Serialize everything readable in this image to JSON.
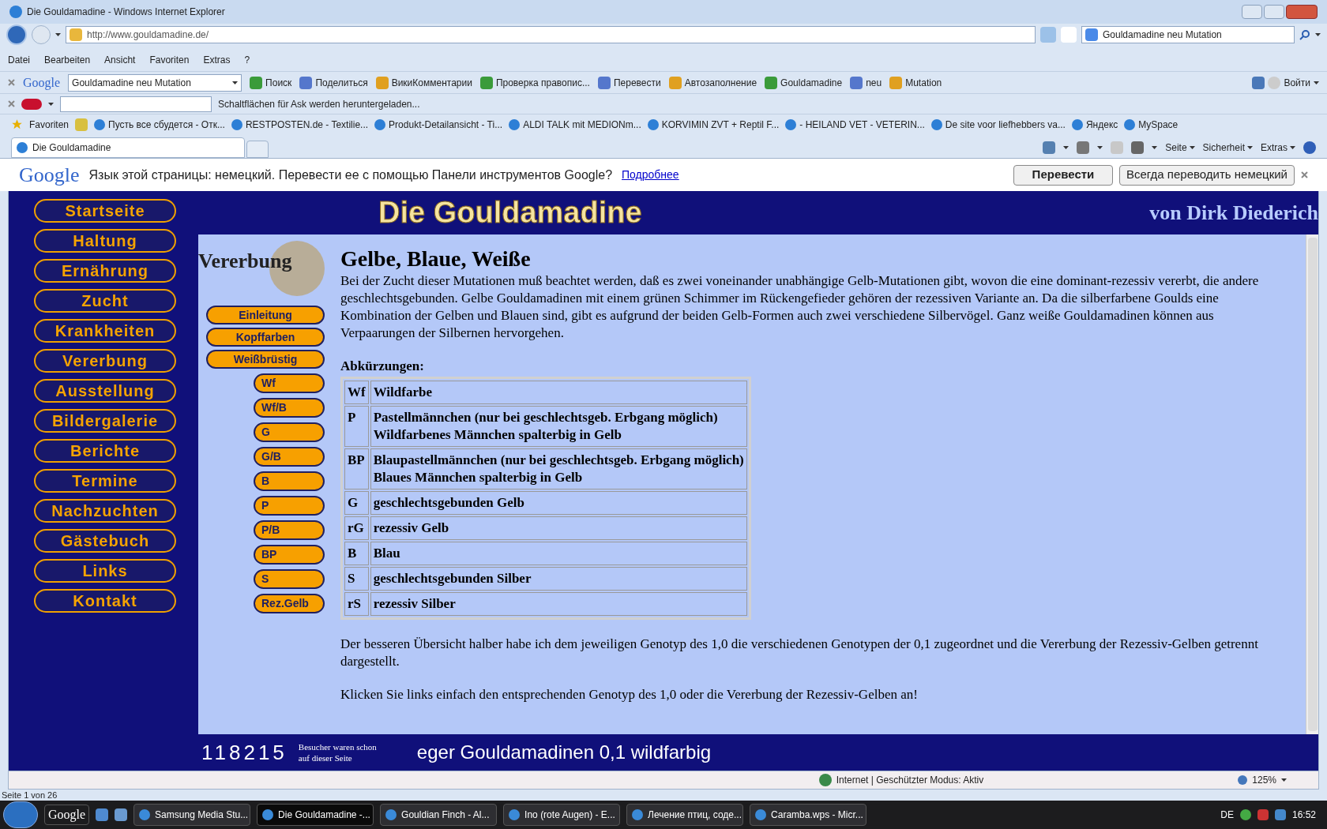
{
  "window": {
    "title": "Die Gouldamadine - Windows Internet Explorer"
  },
  "address": {
    "url": "http://www.gouldamadine.de/"
  },
  "search": {
    "value": "Gouldamadine neu Mutation"
  },
  "menu": [
    "Datei",
    "Bearbeiten",
    "Ansicht",
    "Favoriten",
    "Extras",
    "?"
  ],
  "google_toolbar": {
    "logo": "Google",
    "query": "Gouldamadine neu Mutation",
    "items": [
      "Поиск",
      "Поделиться",
      "ВикиКомментарии",
      "Проверка правопис...",
      "Перевести",
      "Автозаполнение",
      "Gouldamadine",
      "neu",
      "Mutation"
    ],
    "sign_in": "Войти"
  },
  "ask_toolbar": {
    "status": "Schaltflächen für Ask werden heruntergeladen..."
  },
  "favorites_bar": {
    "label": "Favoriten",
    "links": [
      "Пусть все сбудется - Отк...",
      "RESTPOSTEN.de - Textilie...",
      "Produkt-Detailansicht - Ti...",
      "ALDI TALK mit MEDIONm...",
      "KORVIMIN ZVT + Reptil F...",
      "- HEILAND VET - VETERIN...",
      "De site voor liefhebbers va...",
      "Яндекс",
      "MySpace"
    ]
  },
  "tabs": [
    {
      "label": "Die Gouldamadine",
      "selected": true
    }
  ],
  "command_bar": [
    "Seite",
    "Sicherheit",
    "Extras"
  ],
  "translate_bar": {
    "logo": "Google",
    "message": "Язык этой страницы: немецкий. Перевести ее с помощью Панели инструментов Google?",
    "link": "Подробнее",
    "buttons": [
      "Перевести",
      "Всегда переводить немецкий"
    ]
  },
  "page": {
    "title": "Die Gouldamadine",
    "author": "von Dirk Diederich",
    "nav": [
      "Startseite",
      "Haltung",
      "Ernährung",
      "Zucht",
      "Krankheiten",
      "Vererbung",
      "Ausstellung",
      "Bildergalerie",
      "Berichte",
      "Termine",
      "Nachzuchten",
      "Gästebuch",
      "Links",
      "Kontakt"
    ],
    "section_logo": "Vererbung",
    "subnav": [
      "Einleitung",
      "Kopffarben",
      "Weißbrüstig"
    ],
    "genotypes": [
      "Wf",
      "Wf/B",
      "G",
      "G/B",
      "B",
      "P",
      "P/B",
      "BP",
      "S",
      "Rez.Gelb"
    ],
    "heading": "Gelbe, Blaue, Weiße",
    "intro": "Bei der Zucht dieser Mutationen muß beachtet werden, daß es zwei voneinander unabhängige Gelb-Mutationen gibt, wovon die eine dominant-rezessiv vererbt, die andere geschlechtsgebunden. Gelbe Gouldamadinen mit einem grünen Schimmer im Rückengefieder gehören der rezessiven Variante an. Da die silberfarbene Goulds eine Kombination der Gelben und Blauen sind, gibt es aufgrund der beiden Gelb-Formen auch zwei verschiedene Silbervögel. Ganz weiße Gouldamadinen können aus Verpaarungen der Silbernen hervorgehen.",
    "abbrev_title": "Abkürzungen:",
    "abbreviations": [
      {
        "code": "Wf",
        "lines": [
          "Wildfarbe"
        ]
      },
      {
        "code": "P",
        "lines": [
          "Pastellmännchen (nur bei geschlechtsgeb. Erbgang möglich)",
          "Wildfarbenes Männchen spalterbig in Gelb"
        ]
      },
      {
        "code": "BP",
        "lines": [
          "Blaupastellmännchen (nur bei geschlechtsgeb. Erbgang möglich)",
          "Blaues Männchen spalterbig in Gelb"
        ]
      },
      {
        "code": "G",
        "lines": [
          "geschlechtsgebunden Gelb"
        ]
      },
      {
        "code": "rG",
        "lines": [
          "rezessiv Gelb"
        ]
      },
      {
        "code": "B",
        "lines": [
          "Blau"
        ]
      },
      {
        "code": "S",
        "lines": [
          "geschlechtsgebunden Silber"
        ]
      },
      {
        "code": "rS",
        "lines": [
          "rezessiv Silber"
        ]
      }
    ],
    "paragraphs": [
      "Der besseren Übersicht halber habe ich dem jeweiligen Genotyp des 1,0 die verschiedenen Genotypen der 0,1 zugeordnet und die Vererbung der Rezessiv-Gelben getrennt dargestellt.",
      "Klicken Sie links einfach den entsprechenden Genotyp des 1,0 oder die Vererbung der Rezessiv-Gelben an!"
    ],
    "counter": "118215",
    "counter_label": [
      "Besucher waren schon",
      "auf dieser Seite"
    ],
    "ticker": "eger Gouldamadinen 0,1 wildfarbig"
  },
  "status_bar": {
    "zone": "Internet | Geschützter Modus: Aktiv",
    "zoom": "125%",
    "page_info": "Seite 1 von 26"
  },
  "taskbar": {
    "toolbar": "Google",
    "items": [
      {
        "label": "Samsung Media Stu...",
        "selected": false
      },
      {
        "label": "Die Gouldamadine -...",
        "selected": true
      },
      {
        "label": "Gouldian Finch - Al...",
        "selected": false
      },
      {
        "label": "Ino (rote Augen) - E...",
        "selected": false
      },
      {
        "label": "Лечение птиц, соде...",
        "selected": false
      },
      {
        "label": "Caramba.wps - Micr...",
        "selected": false
      }
    ],
    "language": "DE",
    "clock": "16:52"
  }
}
